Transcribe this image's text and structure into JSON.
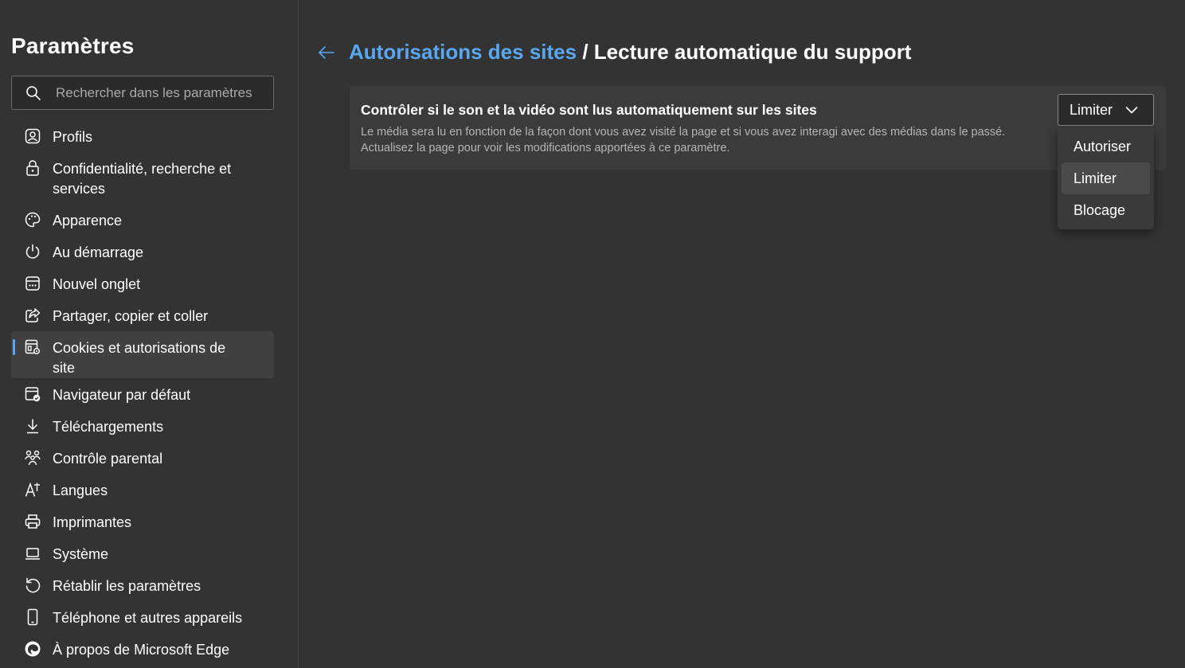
{
  "sidebar": {
    "title": "Paramètres",
    "search_placeholder": "Rechercher dans les paramètres",
    "items": [
      {
        "label": "Profils",
        "icon": "profile-icon"
      },
      {
        "label": "Confidentialité, recherche et services",
        "icon": "lock-icon"
      },
      {
        "label": "Apparence",
        "icon": "palette-icon"
      },
      {
        "label": "Au démarrage",
        "icon": "power-icon"
      },
      {
        "label": "Nouvel onglet",
        "icon": "new-tab-icon"
      },
      {
        "label": "Partager, copier et coller",
        "icon": "share-icon"
      },
      {
        "label": "Cookies et autorisations de site",
        "icon": "cookies-settings-icon",
        "active": true
      },
      {
        "label": "Navigateur par défaut",
        "icon": "default-browser-icon"
      },
      {
        "label": "Téléchargements",
        "icon": "download-icon"
      },
      {
        "label": "Contrôle parental",
        "icon": "family-icon"
      },
      {
        "label": "Langues",
        "icon": "languages-icon"
      },
      {
        "label": "Imprimantes",
        "icon": "printer-icon"
      },
      {
        "label": "Système",
        "icon": "laptop-icon"
      },
      {
        "label": "Rétablir les paramètres",
        "icon": "reset-icon"
      },
      {
        "label": "Téléphone et autres appareils",
        "icon": "phone-icon"
      },
      {
        "label": "À propos de Microsoft Edge",
        "icon": "edge-logo-icon"
      }
    ]
  },
  "header": {
    "breadcrumb_link": "Autorisations des sites",
    "separator": "/",
    "current": "Lecture automatique du support"
  },
  "setting": {
    "title": "Contrôler si le son et la vidéo sont lus automatiquement sur les sites",
    "description_line1": "Le média sera lu en fonction de la façon dont vous avez visité la page et si vous avez interagi avec des médias dans le passé.",
    "description_line2": "Actualisez la page pour voir les modifications apportées à ce paramètre.",
    "select_value": "Limiter",
    "options": [
      "Autoriser",
      "Limiter",
      "Blocage"
    ],
    "selected_index": 1
  },
  "colors": {
    "background": "#333333",
    "accent": "#5aa7f0",
    "card": "#3b3b3b"
  }
}
